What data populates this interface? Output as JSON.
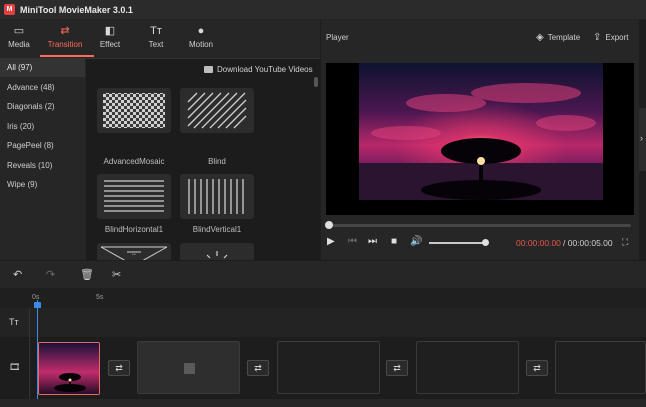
{
  "app": {
    "title": "MiniTool MovieMaker 3.0.1",
    "logo": "M"
  },
  "toolbar": {
    "items": [
      {
        "label": "Media",
        "icon": "folder-icon",
        "glyph": "▭"
      },
      {
        "label": "Transition",
        "icon": "transition-icon",
        "glyph": "⇄"
      },
      {
        "label": "Effect",
        "icon": "effect-icon",
        "glyph": "◧"
      },
      {
        "label": "Text",
        "icon": "text-icon",
        "glyph": "Tт"
      },
      {
        "label": "Motion",
        "icon": "motion-icon",
        "glyph": "●"
      }
    ],
    "active": "Transition"
  },
  "categories": [
    {
      "label": "All (97)"
    },
    {
      "label": "Advance (48)"
    },
    {
      "label": "Diagonals (2)"
    },
    {
      "label": "Iris (20)"
    },
    {
      "label": "PagePeel (8)"
    },
    {
      "label": "Reveals (10)"
    },
    {
      "label": "Wipe (9)"
    }
  ],
  "download": {
    "label": "Download YouTube Videos"
  },
  "transitions": [
    {
      "label": "AdvancedMosaic",
      "pattern": "mosaic"
    },
    {
      "label": "Blind",
      "pattern": "diagonal"
    },
    {
      "label": "BlindHorizontal1",
      "pattern": "horizontal"
    },
    {
      "label": "BlindVertical1",
      "pattern": "vertical"
    },
    {
      "label": "",
      "pattern": "cross"
    },
    {
      "label": "",
      "pattern": "burst"
    }
  ],
  "player": {
    "label": "Player",
    "template_label": "Template",
    "export_label": "Export",
    "time_current": "00:00:00.00",
    "time_total": "/ 00:00:05.00",
    "seek_progress": 0,
    "volume_level": 0.9
  },
  "timeline": {
    "ticks": [
      "0s",
      "5s"
    ]
  },
  "colors": {
    "accent": "#ff6a5c",
    "playhead": "#3b8ae8",
    "time_current": "#e5584a"
  }
}
